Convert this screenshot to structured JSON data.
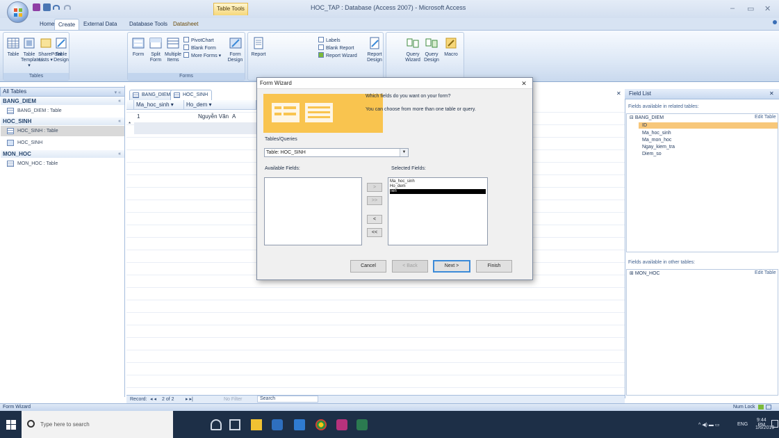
{
  "title_bar": {
    "app_title": "HOC_TAP : Database (Access 2007) - Microsoft Access",
    "table_tools": "Table Tools",
    "window_controls": [
      "–",
      "▭",
      "✕"
    ]
  },
  "ribbon": {
    "tabs": [
      "Home",
      "Create",
      "External Data",
      "Database Tools",
      "Datasheet"
    ],
    "active_tab": "Create",
    "groups": {
      "tables": {
        "label": "Tables",
        "buttons": [
          "Table",
          "Table Templates ▾",
          "SharePoint Lists ▾",
          "Table Design"
        ]
      },
      "forms": {
        "label": "Forms",
        "buttons": [
          "Form",
          "Split Form",
          "Multiple Items"
        ],
        "small_buttons": [
          "PivotChart",
          "Blank Form",
          "More Forms ▾"
        ],
        "design": "Form Design"
      },
      "reports": {
        "buttons": [
          "Report"
        ],
        "small_buttons": [
          "Labels",
          "Blank Report",
          "Report Wizard"
        ],
        "design": "Report Design"
      },
      "other": {
        "buttons": [
          "Query Wizard",
          "Query Design",
          "Macro"
        ]
      }
    }
  },
  "nav_pane": {
    "header": "All Tables",
    "groups": [
      {
        "name": "BANG_DIEM",
        "items": [
          "BANG_DIEM : Table"
        ]
      },
      {
        "name": "HOC_SINH",
        "items": [
          "HOC_SINH : Table",
          "HOC_SINH"
        ]
      },
      {
        "name": "MON_HOC",
        "items": [
          "MON_HOC : Table"
        ]
      }
    ]
  },
  "document": {
    "tabs": [
      "BANG_DIEM",
      "HOC_SINH"
    ],
    "columns": [
      "Ma_hoc_sinh ▾",
      "Ho_dem ▾"
    ],
    "rows": [
      {
        "marker": "",
        "values": [
          "1",
          "Nguyễn Văn",
          "A"
        ]
      },
      {
        "marker": "*",
        "values": [
          "",
          "",
          ""
        ]
      }
    ],
    "record_nav": {
      "label": "Record:",
      "position": "2 of 2",
      "filter": "No Filter",
      "search": "Search"
    }
  },
  "field_list": {
    "title": "Field List",
    "related_label": "Fields available in related tables:",
    "related_table": "BANG_DIEM",
    "edit_table": "Edit Table",
    "related_fields": [
      "ID",
      "Ma_hoc_sinh",
      "Ma_mon_hoc",
      "Ngay_kiem_tra",
      "Diem_so"
    ],
    "selected_field": "ID",
    "other_label": "Fields available in other tables:",
    "other_table": "MON_HOC",
    "other_edit": "Edit Table"
  },
  "wizard": {
    "title": "Form Wizard",
    "close": "✕",
    "question": "Which fields do you want on your form?",
    "hint": "You can choose from more than one table or query.",
    "tables_label": "Tables/Queries",
    "tables_value": "Table: HOC_SINH",
    "available_label": "Available Fields:",
    "selected_label": "Selected Fields:",
    "selected_fields": [
      "Ma_hoc_sinh",
      "Ho_dem",
      "Ten"
    ],
    "highlighted": "Ten",
    "move_buttons": [
      ">",
      ">>",
      "<",
      "<<"
    ],
    "buttons": {
      "cancel": "Cancel",
      "back": "< Back",
      "next": "Next >",
      "finish": "Finish"
    }
  },
  "status": {
    "left": "Form Wizard",
    "right": "Num Lock"
  },
  "taskbar": {
    "search_placeholder": "Type here to search",
    "time": "9:44 PM",
    "date": "1/6/2019",
    "lang": "ENG"
  },
  "colors": {
    "ribbon_blue": "#dde8f6",
    "table_tools_gold": "#f6d77a",
    "selection_black": "#000000",
    "field_highlight": "#f7c77a",
    "taskbar": "#1d2f47"
  }
}
